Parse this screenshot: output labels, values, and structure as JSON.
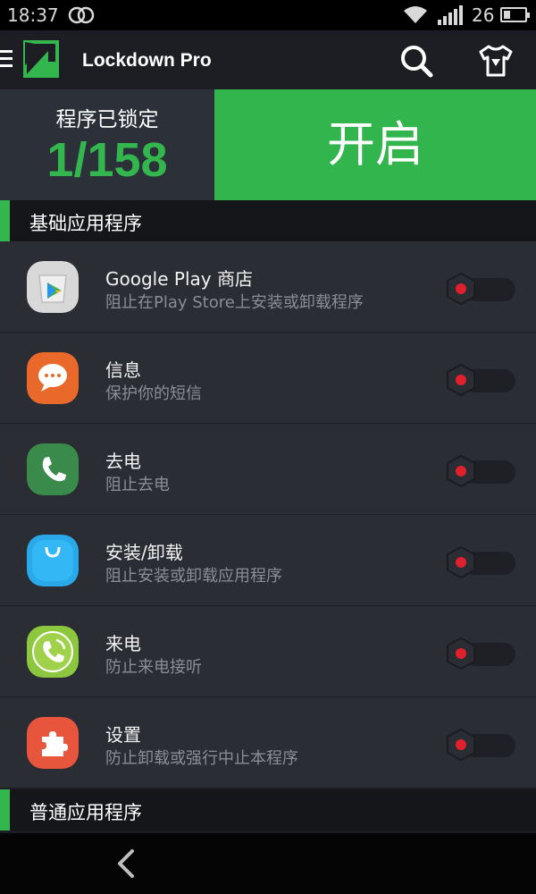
{
  "status": {
    "time": "18:37",
    "battery_level": "26"
  },
  "app": {
    "title": "Lockdown Pro",
    "brand_color": "#32b54c"
  },
  "summary": {
    "locked_label": "程序已锁定",
    "locked_count": "1/158",
    "enable_label": "开启"
  },
  "sections": {
    "basic": "基础应用程序",
    "normal": "普通应用程序"
  },
  "apps": [
    {
      "name": "Google Play 商店",
      "desc": "阻止在Play Store上安装或卸载程序",
      "icon": "google-play-icon",
      "locked": false
    },
    {
      "name": "信息",
      "desc": "保护你的短信",
      "icon": "messages-icon",
      "locked": false
    },
    {
      "name": "去电",
      "desc": "阻止去电",
      "icon": "phone-icon",
      "locked": false
    },
    {
      "name": "安装/卸载",
      "desc": "阻止安装或卸载应用程序",
      "icon": "installer-icon",
      "locked": false
    },
    {
      "name": "来电",
      "desc": "防止来电接听",
      "icon": "incoming-call-icon",
      "locked": false
    },
    {
      "name": "设置",
      "desc": "防止卸载或强行中止本程序",
      "icon": "settings-puzzle-icon",
      "locked": false
    }
  ]
}
